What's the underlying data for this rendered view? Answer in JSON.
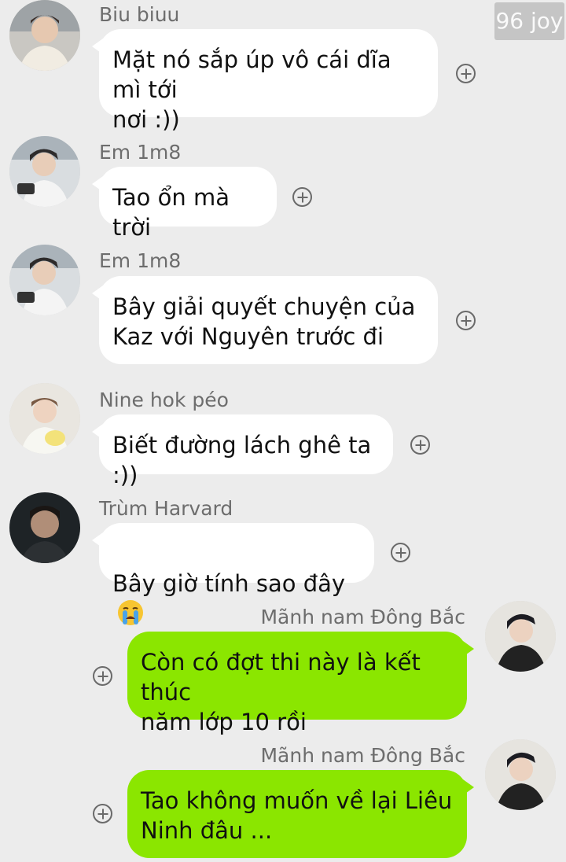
{
  "watermark": "96 joy",
  "messages": [
    {
      "sender": "Biu biuu",
      "text": "Mặt nó sắp úp vô cái dĩa mì tới\nnơi :))"
    },
    {
      "sender": "Em 1m8",
      "text": "Tao ổn mà trời"
    },
    {
      "sender": "Em 1m8",
      "text": "Bây giải quyết chuyện của\nKaz với Nguyên trước đi"
    },
    {
      "sender": "Nine hok péo",
      "text": "Biết đường lách ghê ta :))"
    },
    {
      "sender": "Trùm Harvard",
      "text": "Bây giờ tính sao đây",
      "emoji": "crying-face-emoji"
    },
    {
      "sender": "Mãnh nam Đông Bắc",
      "text": "Còn có đợt thi này là kết thúc\nnăm lớp 10 rồi"
    },
    {
      "sender": "Mãnh nam Đông Bắc",
      "text": "Tao không muốn về lại Liêu\nNinh đâu ..."
    }
  ],
  "colors": {
    "background": "#ececec",
    "incoming_bubble": "#ffffff",
    "outgoing_bubble": "#8be600",
    "sender_name": "#6d6d6d"
  },
  "icons": {
    "add_reaction": "plus-circle-icon",
    "avatar": "avatar-photo"
  }
}
